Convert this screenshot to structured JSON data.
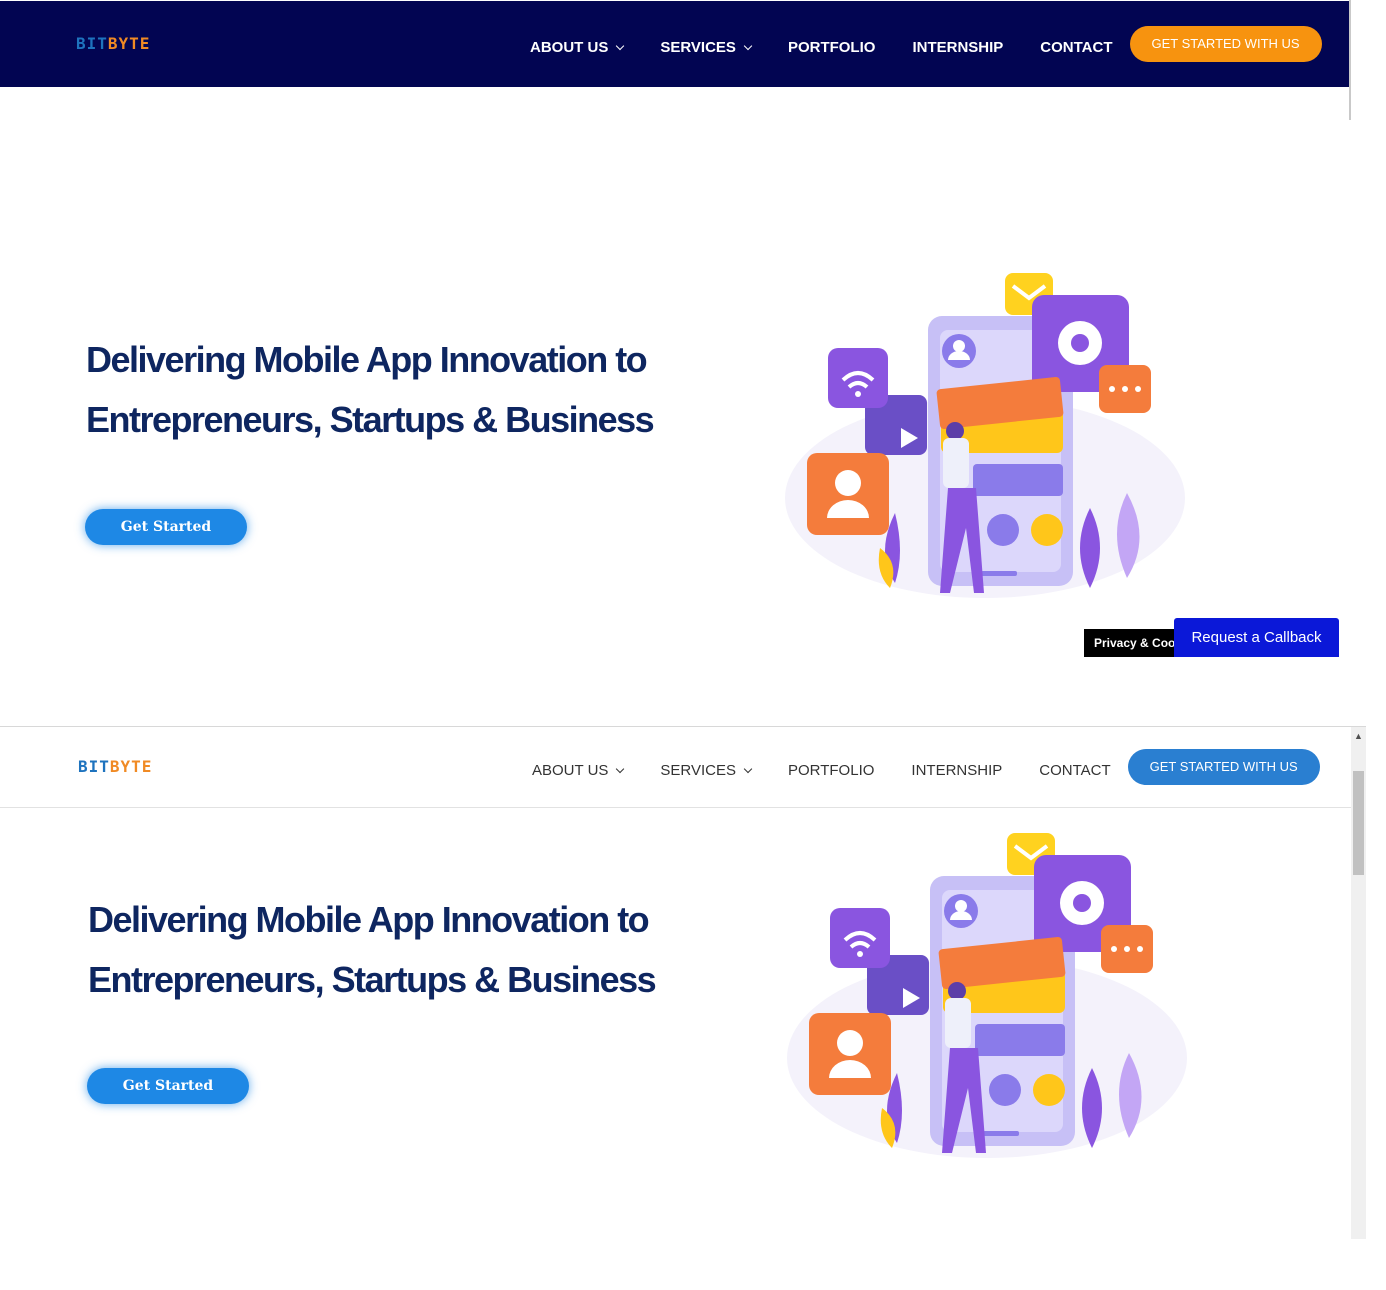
{
  "logo": {
    "part1": "BIT",
    "part2": "BYTE"
  },
  "nav": {
    "about_us": "ABOUT US",
    "services": "SERVICES",
    "portfolio": "PORTFOLIO",
    "internship": "INTERNSHIP",
    "contact": "CONTACT",
    "cta": "GET STARTED WITH US"
  },
  "hero": {
    "headline_line1": "Delivering Mobile App Innovation to",
    "headline_line2": "Entrepreneurs, Startups & Business",
    "button": "Get Started"
  },
  "cookie_notice": "Privacy & Cookies",
  "callback": "Request a Callback",
  "colors": {
    "navy": "#020552",
    "orange": "#f7930f",
    "blue_cta": "#2a7fd1",
    "headline": "#0e2660",
    "button_blue": "#1e88e5",
    "callback_blue": "#0b18d8"
  }
}
